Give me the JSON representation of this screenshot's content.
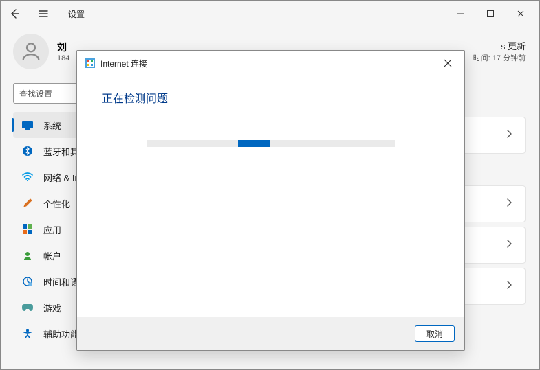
{
  "titlebar": {
    "title": "设置"
  },
  "user": {
    "name": "刘",
    "detail": "184"
  },
  "search": {
    "placeholder": "查找设置"
  },
  "nav": {
    "items": [
      {
        "label": "系统"
      },
      {
        "label": "蓝牙和其"
      },
      {
        "label": "网络 & In"
      },
      {
        "label": "个性化"
      },
      {
        "label": "应用"
      },
      {
        "label": "帐户"
      },
      {
        "label": "时间和语"
      },
      {
        "label": "游戏"
      },
      {
        "label": "辅助功能"
      }
    ]
  },
  "main": {
    "update_title": "s 更新",
    "update_sub": "时间: 17 分钟前"
  },
  "dialog": {
    "title": "Internet 连接",
    "heading": "正在检测问题",
    "cancel": "取消"
  }
}
